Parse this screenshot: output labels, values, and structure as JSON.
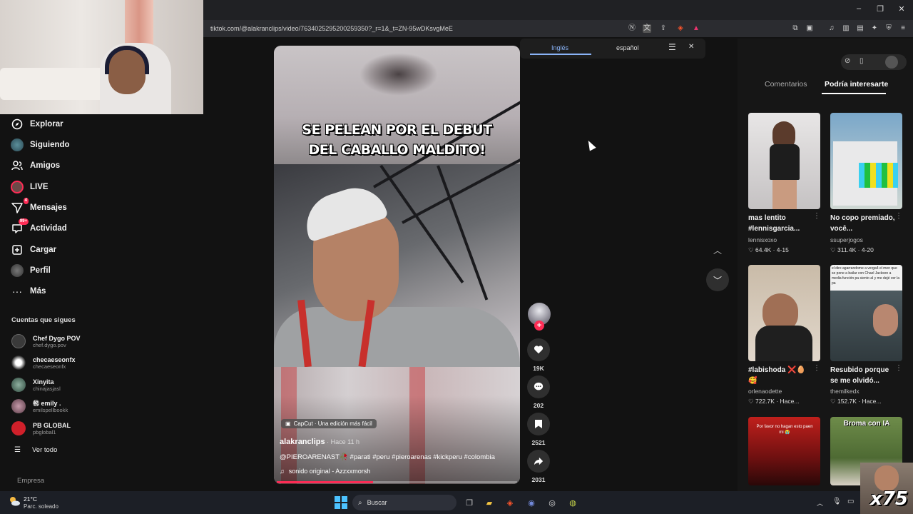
{
  "browser": {
    "url": "tiktok.com/@alakranclips/video/7634025295200259350?_r=1&_t=ZN-95wDKsvgMeE",
    "window_controls": [
      "minimize-icon",
      "maximize-icon",
      "close-icon"
    ]
  },
  "translate_popup": {
    "source_lang": "Inglés",
    "target_lang": "español"
  },
  "sidebar": {
    "items": [
      {
        "label": "Explorar",
        "icon": "compass-icon"
      },
      {
        "label": "Siguiendo",
        "icon": "following-icon"
      },
      {
        "label": "Amigos",
        "icon": "friends-icon"
      },
      {
        "label": "LIVE",
        "icon": "live-icon"
      },
      {
        "label": "Mensajes",
        "icon": "messages-icon",
        "badge": "4"
      },
      {
        "label": "Actividad",
        "icon": "activity-icon",
        "badge": "99+"
      },
      {
        "label": "Cargar",
        "icon": "upload-icon"
      },
      {
        "label": "Perfil",
        "icon": "profile-icon"
      },
      {
        "label": "Más",
        "icon": "more-icon"
      }
    ],
    "following_title": "Cuentas que sigues",
    "accounts": [
      {
        "name": "Chef Dygo POV",
        "handle": "chef.dygo.pov",
        "color": "#444444"
      },
      {
        "name": "checaeseonfx",
        "handle": "checaeseonfx",
        "color": "#eeeeee"
      },
      {
        "name": "Xinyita",
        "handle": "chinajasjasl",
        "color": "#4a6a5a"
      },
      {
        "name": "㊗ emily .",
        "handle": "emilspellbookk",
        "color": "#8a6a7a"
      },
      {
        "name": "PB GLOBAL",
        "handle": "pbglobal1",
        "color": "#d0202a"
      }
    ],
    "see_all": "Ver todo",
    "footer": "Empresa"
  },
  "video": {
    "overlay_caption_line1": "SE PELEAN POR EL DEBUT",
    "overlay_caption_line2": "DEL CABALLO MALDITO!",
    "capcut_label": "CapCut · Una edición más fácil",
    "author": "alakranclips",
    "time_ago": " · Hace 11 h",
    "description": "@PIEROARENAST🥀 #parati #peru #pieroarenas #kickperu #colombia",
    "music": "sonido original - Azzxxmorsh",
    "progress": 0.4
  },
  "actions": {
    "likes": "19K",
    "comments": "202",
    "saves": "2521",
    "shares": "2031"
  },
  "right_panel": {
    "tabs": [
      "Comentarios",
      "Podría interesarte"
    ],
    "active_tab": "Podría interesarte",
    "recommendations": [
      {
        "title": "mas lentito #lennisgarcia...",
        "user": "lennisxoxo",
        "likes": "64.4K",
        "date": "4-15"
      },
      {
        "title": "No copo premiado, você...",
        "user": "ssuperjogos",
        "likes": "311.4K",
        "date": "4-20"
      },
      {
        "title": "#labishoda ❌🥚 🥰",
        "user": "orlenaodette",
        "likes": "722.7K",
        "date": "Hace..."
      },
      {
        "title": "Resubido porque se me olvidó...",
        "user": "themilkedx",
        "likes": "152.7K",
        "date": "Hace..."
      }
    ],
    "thumb_texts": [
      "Por favor no hagan esto paen mi 😭",
      "Broma con IA"
    ],
    "comment_snippet": "el dire agarrandome a verga4 el men que se pone a bailar con Chael Jackson a media función pa siento aI y me dejé ver la pa"
  },
  "taskbar": {
    "temperature": "21°C",
    "weather": "Parc. soleado",
    "search_placeholder": "Buscar"
  },
  "stream_overlay": {
    "multiplier": "x75"
  },
  "colors": {
    "accent": "#fe2c55",
    "background": "#121212"
  }
}
